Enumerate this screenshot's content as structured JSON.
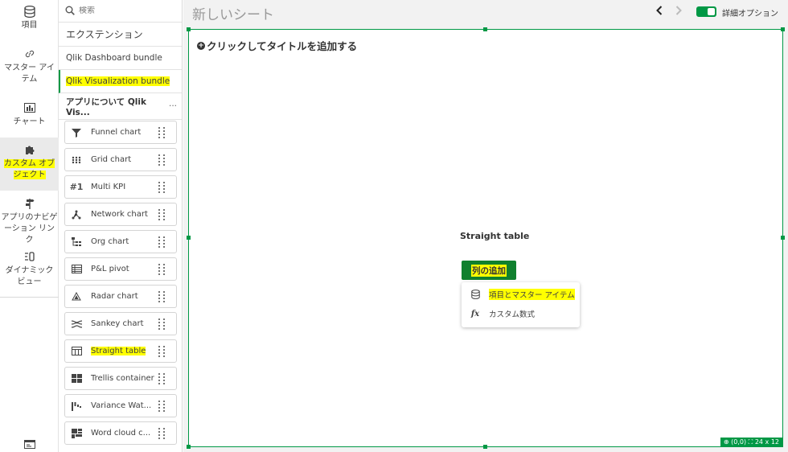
{
  "rail": {
    "items": [
      {
        "label": "項目",
        "icon": "database-icon"
      },
      {
        "label": "マスター アイテム",
        "icon": "link-icon"
      },
      {
        "label": "チャート",
        "icon": "bar-chart-icon"
      },
      {
        "label": "カスタム オブジェクト",
        "icon": "puzzle-icon"
      },
      {
        "label": "アプリのナビゲーション リンク",
        "icon": "signpost-icon"
      },
      {
        "label": "ダイナミック ビュー",
        "icon": "dynamic-view-icon"
      }
    ],
    "bottom_icon": "sheet-properties-icon"
  },
  "panel": {
    "search_placeholder": "検索",
    "extensions_header": "エクステンション",
    "bundles": [
      "Qlik Dashboard bundle",
      "Qlik Visualization bundle"
    ],
    "about_label": "アプリについて Qlik Vis...",
    "more": "···",
    "extensions": [
      {
        "label": "Funnel chart",
        "icon": "funnel-icon"
      },
      {
        "label": "Grid chart",
        "icon": "grid-chart-icon"
      },
      {
        "label": "Multi KPI",
        "icon": "multi-kpi-icon",
        "glyph": "#1"
      },
      {
        "label": "Network chart",
        "icon": "network-chart-icon"
      },
      {
        "label": "Org chart",
        "icon": "org-chart-icon"
      },
      {
        "label": "P&L pivot",
        "icon": "pl-pivot-icon"
      },
      {
        "label": "Radar chart",
        "icon": "radar-chart-icon"
      },
      {
        "label": "Sankey chart",
        "icon": "sankey-chart-icon"
      },
      {
        "label": "Straight table",
        "icon": "table-icon"
      },
      {
        "label": "Trellis container",
        "icon": "trellis-icon"
      },
      {
        "label": "Variance Wat...",
        "icon": "variance-waterfall-icon"
      },
      {
        "label": "Word cloud c...",
        "icon": "word-cloud-icon"
      }
    ]
  },
  "topbar": {
    "sheet_title": "新しいシート",
    "advanced_options": "詳細オプション",
    "toggle_on": true
  },
  "sheet": {
    "add_title": "クリックしてタイトルを追加する",
    "object_label": "Straight table",
    "add_column_button": "列の追加",
    "dropdown": [
      {
        "label": "項目とマスター アイテム",
        "icon": "database-icon"
      },
      {
        "label": "カスタム数式",
        "icon": "fx-icon",
        "glyph": "fx"
      }
    ],
    "status_position": "(0,0)",
    "status_size": "24 x 12"
  },
  "colors": {
    "accent": "#009845",
    "highlight": "#ffff00",
    "button": "#10802e"
  }
}
